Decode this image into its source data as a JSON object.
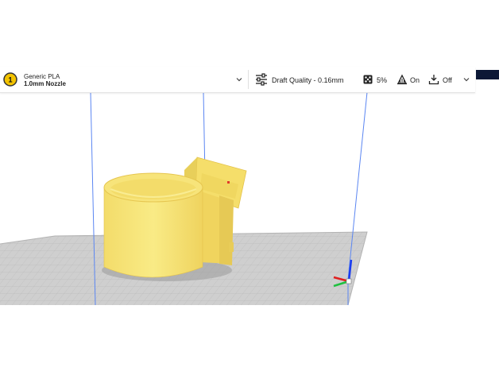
{
  "toolbar": {
    "extruder_number": "1",
    "material": "Generic PLA",
    "nozzle": "1.0mm Nozzle",
    "profile": "Draft Quality - 0.16mm",
    "infill": "5%",
    "support": "On",
    "adhesion": "Off"
  },
  "icons": {
    "extruder": "extruder-badge-icon",
    "settings": "sliders-icon",
    "infill": "infill-icon",
    "support": "support-icon",
    "adhesion": "adhesion-icon",
    "dropdown": "chevron-down-icon"
  },
  "colors": {
    "model": "#f5e06b",
    "extruder_badge": "#f3c300",
    "build_plate": "#d2d2d2",
    "axis_x": "#e02020",
    "axis_y": "#20c040",
    "axis_z": "#1a3cf0",
    "accent_box": "#0c1836"
  }
}
